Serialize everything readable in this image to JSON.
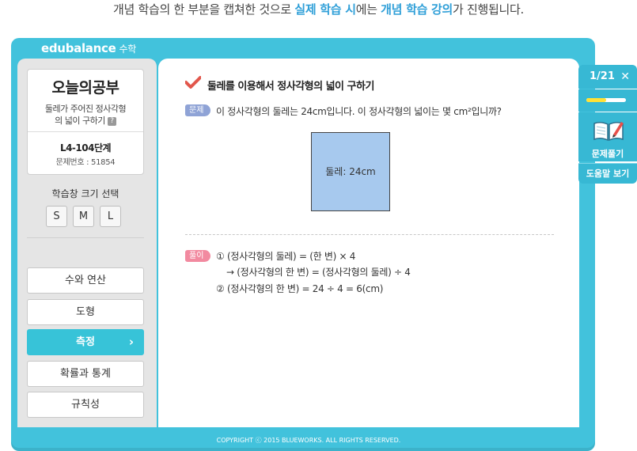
{
  "caption": {
    "part1": "개념 학습의 한 부분을 캡쳐한 것으로 ",
    "hl1": "실제 학습 시",
    "part2": "에는 ",
    "hl2": "개념 학습 강의",
    "part3": "가 진행됩니다."
  },
  "brand": {
    "name": "edubalance",
    "sub": "수학"
  },
  "today": {
    "title": "오늘의공부",
    "desc_line1": "둘레가 주어진 정사각형",
    "desc_line2": "의 넓이 구하기",
    "help": "?",
    "level": "L4-104단계",
    "problem_no": "문제번호 : 51854"
  },
  "size_select": {
    "label": "학습창 크기 선택",
    "options": [
      "S",
      "M",
      "L"
    ]
  },
  "menu": [
    {
      "label": "수와 연산"
    },
    {
      "label": "도형"
    },
    {
      "label": "측정",
      "active": true
    },
    {
      "label": "확률과 통계"
    },
    {
      "label": "규칙성"
    }
  ],
  "problem": {
    "title": "둘레를 이용해서 정사각형의 넓이 구하기",
    "question_tag": "문제",
    "question": "이 정사각형의 둘레는 24cm입니다. 이 정사각형의 넓이는 몇 cm²입니까?",
    "figure_label": "둘레: 24cm",
    "solution_tag": "풀이",
    "solution": [
      "① (정사각형의 둘레) = (한 변) × 4",
      "→ (정사각형의 한 변) = (정사각형의 둘레) ÷ 4",
      "② (정사각형의 한 변) = 24 ÷ 4 = 6(cm)"
    ]
  },
  "footer": {
    "copyright": "COPYRIGHT ⓒ 2015 BLUEWORKS. ALL RIGHTS RESERVED."
  },
  "right_panel": {
    "counter": "1/21",
    "close": "✕",
    "progress": 0.5,
    "solve_label": "문제풀기",
    "help_label": "도움말 보기"
  },
  "colors": {
    "frame": "#42c2dc",
    "accent": "#37c3d8",
    "highlight": "#2f9fd8",
    "progress": "#ffe135"
  }
}
